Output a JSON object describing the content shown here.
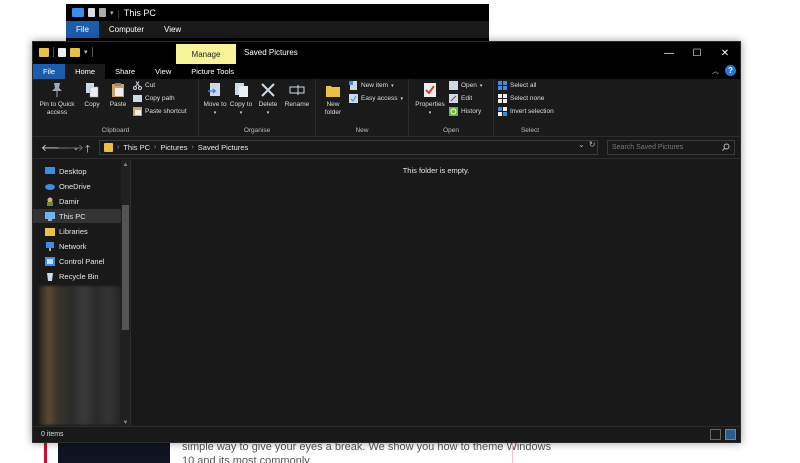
{
  "background": {
    "text_lines": [
      "simple way to give your eyes a break. We show you how to theme Windows",
      "10 and its most commonly"
    ]
  },
  "back_window": {
    "title": "This PC",
    "tabs": [
      "File",
      "Computer",
      "View"
    ]
  },
  "window": {
    "title": "Saved Pictures",
    "contextual_tab": "Manage",
    "controls": {
      "minimize": "—",
      "maximize": "☐",
      "close": "✕"
    }
  },
  "ribbon_tabs": [
    "File",
    "Home",
    "Share",
    "View",
    "Picture Tools"
  ],
  "ribbon": {
    "clipboard": {
      "label": "Clipboard",
      "pin": "Pin to Quick access",
      "copy": "Copy",
      "paste": "Paste",
      "cut": "Cut",
      "copy_path": "Copy path",
      "paste_shortcut": "Paste shortcut"
    },
    "organise": {
      "label": "Organise",
      "move_to": "Move to",
      "copy_to": "Copy to",
      "delete": "Delete",
      "rename": "Rename"
    },
    "new": {
      "label": "New",
      "new_folder": "New folder",
      "new_item": "New item",
      "easy_access": "Easy access"
    },
    "open": {
      "label": "Open",
      "properties": "Properties",
      "open": "Open",
      "edit": "Edit",
      "history": "History"
    },
    "select": {
      "label": "Select",
      "select_all": "Select all",
      "select_none": "Select none",
      "invert_selection": "Invert selection"
    }
  },
  "address": {
    "crumbs": [
      "This PC",
      "Pictures",
      "Saved Pictures"
    ],
    "search_placeholder": "Search Saved Pictures"
  },
  "nav": {
    "items": [
      {
        "label": "Desktop",
        "icon": "desktop-icon"
      },
      {
        "label": "OneDrive",
        "icon": "onedrive-icon"
      },
      {
        "label": "Damir",
        "icon": "user-icon"
      },
      {
        "label": "This PC",
        "icon": "this-pc-icon"
      },
      {
        "label": "Libraries",
        "icon": "libraries-icon"
      },
      {
        "label": "Network",
        "icon": "network-icon"
      },
      {
        "label": "Control Panel",
        "icon": "control-panel-icon"
      },
      {
        "label": "Recycle Bin",
        "icon": "recycle-bin-icon"
      }
    ],
    "selected": "This PC"
  },
  "content": {
    "empty_message": "This folder is empty."
  },
  "status": {
    "items_text": "0 items"
  },
  "colors": {
    "accent": "#1c5cab",
    "manage_tab": "#f8f598",
    "window_bg": "#191919"
  }
}
